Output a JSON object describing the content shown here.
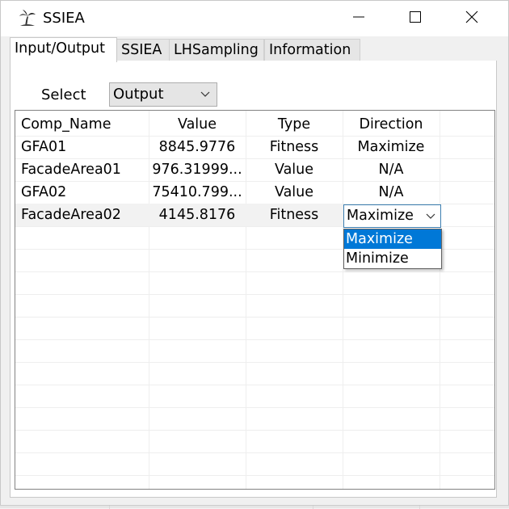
{
  "window": {
    "title": "SSIEA",
    "app_icon": "palm-tree-icon",
    "controls": [
      "minimize-icon",
      "maximize-icon",
      "close-icon"
    ]
  },
  "tabs": [
    {
      "label": "Input/Output",
      "active": true
    },
    {
      "label": "SSIEA",
      "active": false
    },
    {
      "label": "LHSampling",
      "active": false
    },
    {
      "label": "Information",
      "active": false
    }
  ],
  "select": {
    "label": "Select",
    "value": "Output"
  },
  "table": {
    "headers": [
      "Comp_Name",
      "Value",
      "Type",
      "Direction"
    ],
    "rows": [
      [
        "GFA01",
        "8845.9776",
        "Fitness",
        "Maximize"
      ],
      [
        "FacadeArea01",
        "976.31999...",
        "Value",
        "N/A"
      ],
      [
        "GFA02",
        "75410.799...",
        "Value",
        "N/A"
      ],
      [
        "FacadeArea02",
        "4145.8176",
        "Fitness",
        "Maximize"
      ]
    ],
    "editing_cell": {
      "value": "Maximize",
      "options": [
        "Maximize",
        "Minimize"
      ],
      "highlighted": "Maximize"
    }
  },
  "colors": {
    "selection": "#0078d7",
    "editor_border": "#3c7fb1"
  }
}
